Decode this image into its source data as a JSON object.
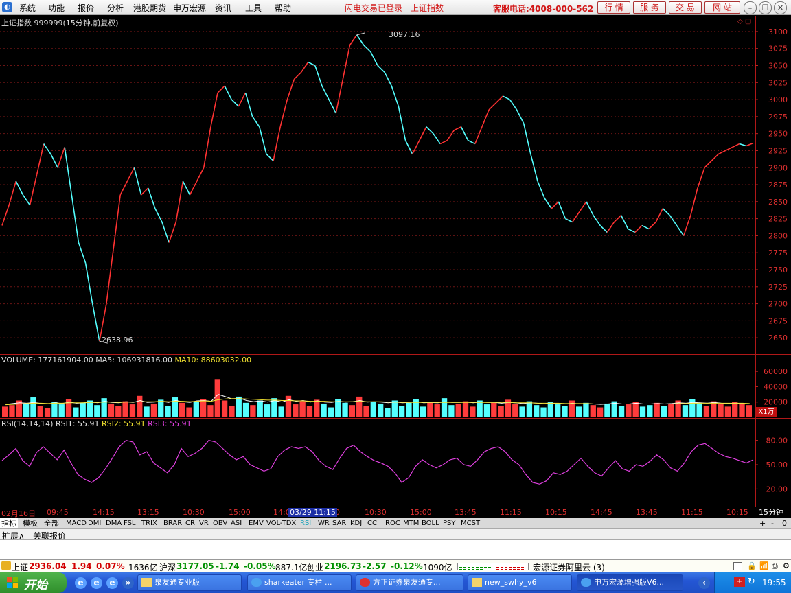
{
  "menu": {
    "items": [
      "系统",
      "功能",
      "报价",
      "分析",
      "港股期货",
      "申万宏源",
      "资讯",
      "工具",
      "帮助"
    ],
    "status_login": "闪电交易已登录",
    "status_index": "上证指数",
    "hotline": "客服电话:4008-000-562",
    "buttons": [
      "行 情",
      "服 务",
      "交 易",
      "网 站"
    ]
  },
  "main_panel": {
    "title": "上证指数 999999(15分钟,前复权)",
    "high_label": "3097.16",
    "low_label": "2638.96"
  },
  "volume_panel": {
    "label": "VOLUME: 177161904.00",
    "ma5": "MA5: 106931816.00",
    "ma10": "MA10: 88603032.00",
    "unit": "X1万"
  },
  "rsi_panel": {
    "label": "RSI(14,14,14)",
    "rsi1": "RSI1: 55.91",
    "rsi2": "RSI2: 55.91",
    "rsi3": "RSI3: 55.91"
  },
  "time_axis": {
    "labels": [
      "02月16日",
      "09:45",
      "14:15",
      "13:15",
      "10:30",
      "15:00",
      "14:0",
      "0",
      "10:30",
      "15:00",
      "13:45",
      "11:15",
      "10:15",
      "14:45",
      "13:45",
      "11:15",
      "10:15"
    ],
    "cursor": "03/29 11:15",
    "period": "15分钟"
  },
  "tabs": [
    "指标",
    "模板",
    "全部",
    "MACD",
    "DMI",
    "DMA",
    "FSL",
    "TRIX",
    "BRAR",
    "CR",
    "VR",
    "OBV",
    "ASI",
    "EMV",
    "VOL-TDX",
    "RSI",
    "WR",
    "SAR",
    "KDJ",
    "CCI",
    "ROC",
    "MTM",
    "BOLL",
    "PSY",
    "MCST"
  ],
  "tab_controls": [
    "+",
    "-",
    "0"
  ],
  "ext_links": [
    "扩展∧",
    "关联报价"
  ],
  "status": {
    "sh_label": "上证",
    "sh_value": "2936.04",
    "sh_change": "1.94",
    "sh_pct": "0.07%",
    "sh_amount": "1636亿",
    "hs_label": "沪深",
    "hs_value": "3177.05",
    "hs_change": "-1.74",
    "hs_pct": "-0.05%",
    "hs_amount": "887.1亿",
    "cy_label": "创业",
    "cy_value": "2196.73",
    "cy_change": "-2.57",
    "cy_pct": "-0.12%",
    "cy_amount": "1090亿",
    "server": "宏源证券阿里云 (3)"
  },
  "taskbar": {
    "start": "开始",
    "tasks": [
      "泉友通专业版",
      "sharkeater 专栏 ...",
      "方正证券泉友通专...",
      "new_swhy_v6",
      "申万宏源增强版V6..."
    ],
    "clock": "19:55"
  },
  "chart_data": [
    {
      "type": "line",
      "title": "上证指数 999999(15分钟,前复权)",
      "ylim": [
        2630,
        3110
      ],
      "yticks": [
        2650,
        2675,
        2700,
        2725,
        2750,
        2775,
        2800,
        2825,
        2850,
        2875,
        2900,
        2925,
        2950,
        2975,
        3000,
        3025,
        3050,
        3075,
        3100
      ],
      "series": [
        {
          "values": [
            2815,
            2845,
            2880,
            2860,
            2845,
            2890,
            2935,
            2920,
            2900,
            2930,
            2860,
            2790,
            2760,
            2700,
            2645,
            2700,
            2780,
            2860,
            2880,
            2900,
            2860,
            2870,
            2840,
            2820,
            2790,
            2820,
            2880,
            2860,
            2880,
            2900,
            2960,
            3010,
            3020,
            3000,
            2990,
            3010,
            2975,
            2960,
            2920,
            2910,
            2960,
            3000,
            3030,
            3040,
            3055,
            3050,
            3020,
            3000,
            2980,
            3030,
            3080,
            3095,
            3080,
            3070,
            3050,
            3040,
            3020,
            2990,
            2940,
            2920,
            2940,
            2960,
            2950,
            2935,
            2940,
            2955,
            2960,
            2940,
            2935,
            2960,
            2985,
            2995,
            3005,
            3000,
            2985,
            2965,
            2920,
            2880,
            2855,
            2840,
            2850,
            2825,
            2820,
            2835,
            2850,
            2830,
            2815,
            2805,
            2820,
            2830,
            2810,
            2805,
            2815,
            2810,
            2820,
            2840,
            2830,
            2815,
            2800,
            2830,
            2870,
            2900,
            2910,
            2920,
            2925,
            2930,
            2935,
            2932,
            2936
          ]
        }
      ]
    },
    {
      "type": "bar",
      "title": "VOLUME",
      "ylim": [
        0,
        70000
      ],
      "yticks": [
        20000,
        40000,
        60000
      ],
      "series": [
        {
          "name": "VOLUME",
          "values": [
            14000,
            16000,
            22000,
            18000,
            26000,
            15000,
            12000,
            20000,
            17000,
            24000,
            13000,
            19000,
            22000,
            16000,
            25000,
            18000,
            15000,
            21000,
            17000,
            28000,
            14000,
            18000,
            23000,
            15000,
            26000,
            19000,
            13000,
            21000,
            24000,
            16000,
            50000,
            22000,
            15000,
            27000,
            19000,
            16000,
            22000,
            17000,
            25000,
            14000,
            28000,
            17000,
            21000,
            15000,
            23000,
            18000,
            13000,
            24000,
            19000,
            16000,
            27000,
            15000,
            20000,
            18000,
            12000,
            22000,
            15000,
            19000,
            24000,
            14000,
            20000,
            17000,
            25000,
            16000,
            18000,
            21000,
            14000,
            22000,
            17000,
            19000,
            15000,
            23000,
            18000,
            14000,
            21000,
            16000,
            13000,
            20000,
            17000,
            15000,
            22000,
            14000,
            19000,
            16000,
            13000,
            18000,
            21000,
            15000,
            17000,
            20000,
            14000,
            16000,
            19000,
            15000,
            18000,
            22000,
            16000,
            24000,
            19000,
            15000,
            21000,
            17000,
            14000,
            20000,
            18000,
            16000
          ]
        },
        {
          "name": "MA5",
          "values": [
            17000,
            18000,
            19000,
            18500,
            19500,
            18000,
            17500,
            19000,
            18000,
            20000,
            18500,
            19000,
            20000,
            19000,
            21000,
            19500,
            19000,
            20500,
            19500,
            22000,
            19500,
            20000,
            21000,
            19500,
            22000,
            20500,
            19500,
            21500,
            22000,
            21000,
            30000,
            27000,
            24000,
            25000,
            22000,
            20500,
            21500,
            20000,
            22000,
            20000,
            23000,
            21000,
            22000,
            20000,
            21500,
            20000,
            19500,
            21000,
            20000,
            20500,
            22000,
            20000,
            20500,
            20000,
            19000,
            20000,
            19000,
            19500,
            20500,
            19000,
            19500,
            19000,
            20500,
            19500,
            19500,
            20000,
            19000,
            20000,
            19500,
            19500,
            18500,
            19500,
            19000,
            18000,
            19000,
            18500,
            17500,
            18500,
            18000,
            17500,
            18500,
            17500,
            18000,
            17500,
            17000,
            17500,
            18500,
            17500,
            17500,
            18500,
            17500,
            17500,
            18000,
            17500,
            18000,
            19000,
            18500,
            19500,
            19000,
            18500,
            19500,
            18500,
            18000,
            18500,
            18000,
            17500
          ]
        },
        {
          "name": "MA10",
          "values": [
            16500,
            17000,
            17500,
            18000,
            18500,
            18500,
            18000,
            18500,
            18500,
            19000,
            19000,
            19000,
            19500,
            19500,
            20000,
            20000,
            19500,
            20000,
            20000,
            20500,
            20500,
            20500,
            21000,
            20500,
            21000,
            21000,
            20500,
            21000,
            21500,
            21000,
            23000,
            24000,
            24500,
            24500,
            24000,
            23500,
            23000,
            22500,
            22500,
            22000,
            22000,
            21500,
            21500,
            21000,
            21000,
            21000,
            20500,
            20500,
            20500,
            20500,
            21000,
            20500,
            20500,
            20500,
            20000,
            20000,
            19500,
            19500,
            19500,
            19500,
            19500,
            19500,
            19500,
            19500,
            19500,
            19500,
            19500,
            19500,
            19500,
            19500,
            19500,
            19500,
            19000,
            19000,
            19000,
            18500,
            18500,
            18500,
            18500,
            18000,
            18000,
            18000,
            18000,
            17500,
            17500,
            17500,
            17500,
            17500,
            17500,
            17500,
            17500,
            17500,
            17500,
            17500,
            17500,
            18000,
            18000,
            18500,
            18500,
            18500,
            18500,
            18500,
            18500,
            18500,
            18500,
            18000
          ]
        }
      ]
    },
    {
      "type": "line",
      "title": "RSI(14,14,14)",
      "ylim": [
        0,
        100
      ],
      "yticks": [
        20,
        50,
        80
      ],
      "series": [
        {
          "name": "RSI1",
          "values": [
            55,
            62,
            70,
            55,
            48,
            65,
            72,
            64,
            56,
            68,
            52,
            38,
            32,
            28,
            34,
            45,
            58,
            72,
            80,
            78,
            62,
            66,
            52,
            46,
            40,
            50,
            70,
            60,
            64,
            70,
            80,
            78,
            70,
            62,
            56,
            60,
            50,
            46,
            42,
            45,
            60,
            68,
            72,
            70,
            72,
            66,
            55,
            48,
            44,
            58,
            70,
            74,
            66,
            60,
            55,
            52,
            48,
            40,
            28,
            34,
            48,
            56,
            50,
            46,
            50,
            56,
            58,
            50,
            48,
            56,
            66,
            70,
            72,
            66,
            56,
            50,
            38,
            28,
            26,
            30,
            40,
            38,
            42,
            50,
            58,
            48,
            40,
            36,
            46,
            55,
            45,
            42,
            50,
            48,
            54,
            62,
            56,
            46,
            42,
            52,
            66,
            74,
            76,
            70,
            64,
            60,
            58,
            55,
            52,
            56
          ]
        }
      ]
    }
  ]
}
